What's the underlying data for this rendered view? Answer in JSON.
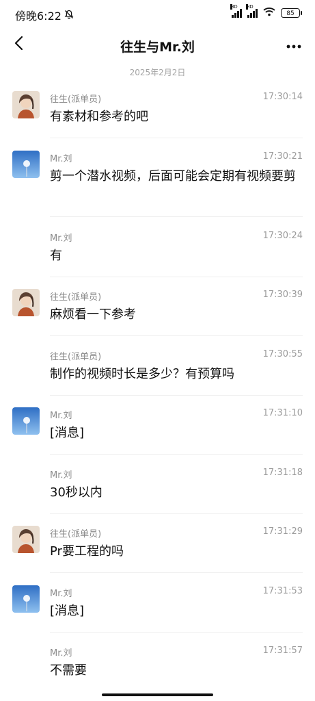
{
  "status_bar": {
    "time": "傍晚6:22",
    "hd1": "HD",
    "hd2": "HD",
    "battery": "85"
  },
  "nav": {
    "title": "往生与Mr.刘"
  },
  "date_divider": "2025年2月2日",
  "messages": [
    {
      "sender": "往生(派单员)",
      "time": "17:30:14",
      "text": "有素材和参考的吧",
      "avatar": "illustrated-person"
    },
    {
      "sender": "Mr.刘",
      "time": "17:30:21",
      "text": "剪一个潜水视频，后面可能会定期有视频要剪",
      "avatar": "dandelion-sky"
    },
    {
      "sender": "Mr.刘",
      "time": "17:30:24",
      "text": "有"
    },
    {
      "sender": "往生(派单员)",
      "time": "17:30:39",
      "text": "麻烦看一下参考",
      "avatar": "illustrated-person"
    },
    {
      "sender": "往生(派单员)",
      "time": "17:30:55",
      "text": "制作的视频时长是多少？有预算吗"
    },
    {
      "sender": "Mr.刘",
      "time": "17:31:10",
      "text": "[消息]",
      "avatar": "dandelion-sky"
    },
    {
      "sender": "Mr.刘",
      "time": "17:31:18",
      "text": "30秒以内"
    },
    {
      "sender": "往生(派单员)",
      "time": "17:31:29",
      "text": "Pr要工程的吗",
      "avatar": "illustrated-person"
    },
    {
      "sender": "Mr.刘",
      "time": "17:31:53",
      "text": "[消息]",
      "avatar": "dandelion-sky"
    },
    {
      "sender": "Mr.刘",
      "time": "17:31:57",
      "text": "不需要"
    }
  ],
  "colors": {
    "background": "#ffffff",
    "secondary_text": "#8a8a8a",
    "divider": "#efefef"
  }
}
